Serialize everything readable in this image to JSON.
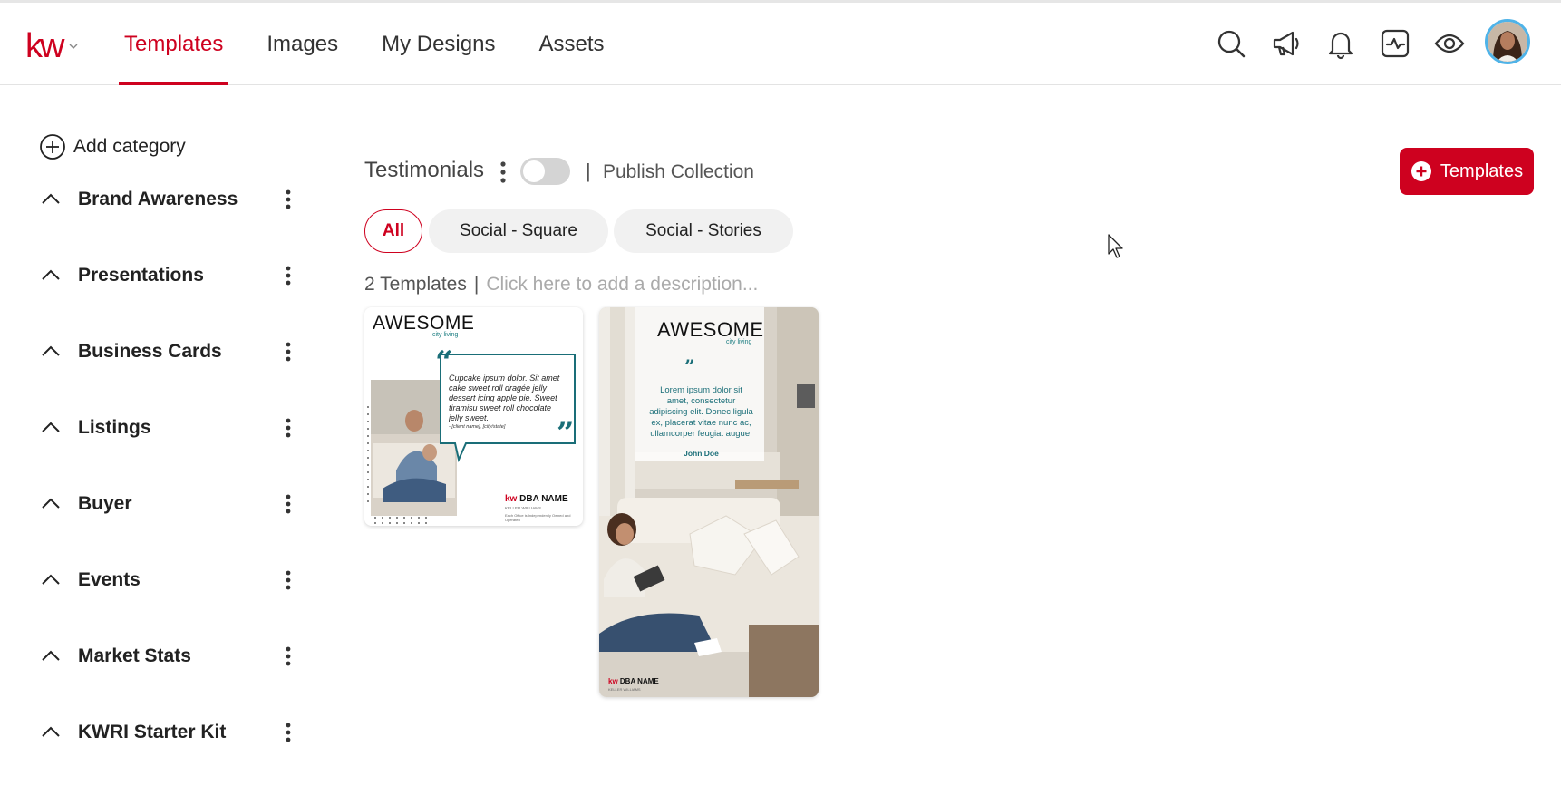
{
  "app": {
    "logo_text": "kw"
  },
  "nav": {
    "tabs": [
      {
        "label": "Templates",
        "active": true
      },
      {
        "label": "Images",
        "active": false
      },
      {
        "label": "My Designs",
        "active": false
      },
      {
        "label": "Assets",
        "active": false
      }
    ]
  },
  "header_icons": [
    "search-icon",
    "megaphone-icon",
    "bell-icon",
    "activity-icon",
    "eye-icon",
    "avatar"
  ],
  "sidebar": {
    "add_category_label": "Add category",
    "categories": [
      {
        "label": "Brand Awareness"
      },
      {
        "label": "Presentations"
      },
      {
        "label": "Business Cards"
      },
      {
        "label": "Listings"
      },
      {
        "label": "Buyer"
      },
      {
        "label": "Events"
      },
      {
        "label": "Market Stats"
      },
      {
        "label": "KWRI Starter Kit"
      }
    ]
  },
  "collection": {
    "title": "Testimonials",
    "published": false,
    "separator": "|",
    "publish_label": "Publish Collection",
    "add_button_label": "Templates",
    "filters": [
      {
        "label": "All",
        "active": true
      },
      {
        "label": "Social - Square",
        "active": false
      },
      {
        "label": "Social - Stories",
        "active": false
      }
    ],
    "count_label": "2 Templates",
    "count_separator": "|",
    "description_placeholder": "Click here to add a description..."
  },
  "templates": [
    {
      "brand": "AWESOME",
      "brand_sub": "city living",
      "quote": "Cupcake ipsum dolor. Sit amet cake sweet roll dragée jelly dessert icing apple pie. Sweet tiramisu sweet roll chocolate jelly sweet.",
      "client": "- [client name], [city/state]",
      "kw": "kw",
      "dba": "DBA NAME",
      "company": "KELLER WILLIAMS",
      "disclaimer": "Each Office is Independently Owned and Operated"
    },
    {
      "brand": "AWESOME",
      "brand_sub": "city living",
      "quote": "Lorem ipsum dolor sit amet, consectetur adipiscing elit. Donec ligula ex, placerat vitae nunc ac, ullamcorper feugiat augue.",
      "author": "John Doe",
      "kw": "kw",
      "dba": "DBA NAME",
      "company": "KELLER WILLIAMS"
    }
  ],
  "colors": {
    "brand_red": "#ce011f",
    "teal": "#1a6e78",
    "chip_bg": "#f1f1f1",
    "avatar_ring": "#4fb3e8"
  }
}
